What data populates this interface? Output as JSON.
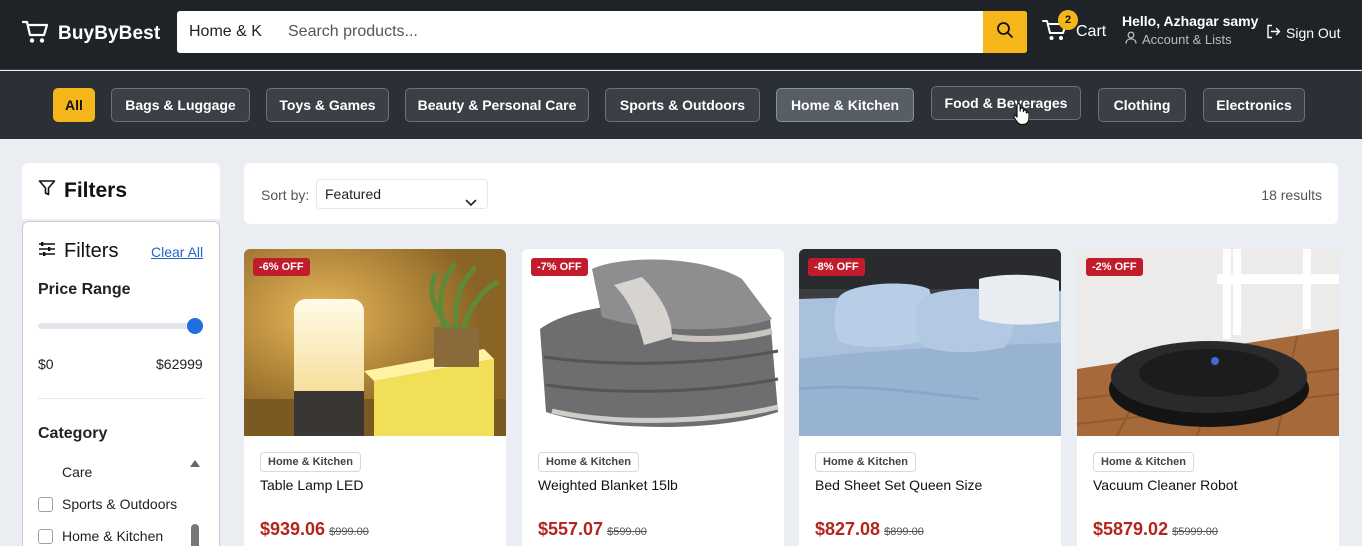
{
  "header": {
    "logo_text": "BuyByBest",
    "search_category": "Home & K",
    "search_placeholder": "Search products...",
    "cart_count": "2",
    "cart_label": "Cart",
    "greeting": "Hello, Azhagar samy",
    "account_label": "Account & Lists",
    "signout_label": "Sign Out"
  },
  "categories": [
    {
      "label": "All"
    },
    {
      "label": "Bags & Luggage"
    },
    {
      "label": "Toys & Games"
    },
    {
      "label": "Beauty & Personal Care"
    },
    {
      "label": "Sports & Outdoors"
    },
    {
      "label": "Home & Kitchen"
    },
    {
      "label": "Food & Beverages"
    },
    {
      "label": "Clothing"
    },
    {
      "label": "Electronics"
    }
  ],
  "filters": {
    "header_title": "Filters",
    "panel_title": "Filters",
    "clear_all": "Clear All",
    "price_title": "Price Range",
    "price_min": "$0",
    "price_max": "$62999",
    "price_slider_fraction": 1.0,
    "category_title": "Category",
    "category_items": [
      {
        "label": "Care"
      },
      {
        "label": "Sports & Outdoors"
      },
      {
        "label": "Home & Kitchen"
      }
    ]
  },
  "sort": {
    "label": "Sort by:",
    "selected": "Featured",
    "results": "18 results"
  },
  "products": [
    {
      "discount": "-6% OFF",
      "category": "Home & Kitchen",
      "name": "Table Lamp LED",
      "price": "$939.06",
      "old_price": "$999.00"
    },
    {
      "discount": "-7% OFF",
      "category": "Home & Kitchen",
      "name": "Weighted Blanket 15lb",
      "price": "$557.07",
      "old_price": "$599.00"
    },
    {
      "discount": "-8% OFF",
      "category": "Home & Kitchen",
      "name": "Bed Sheet Set Queen Size",
      "price": "$827.08",
      "old_price": "$899.00"
    },
    {
      "discount": "-2% OFF",
      "category": "Home & Kitchen",
      "name": "Vacuum Cleaner Robot",
      "price": "$5879.02",
      "old_price": "$5999.00"
    }
  ]
}
